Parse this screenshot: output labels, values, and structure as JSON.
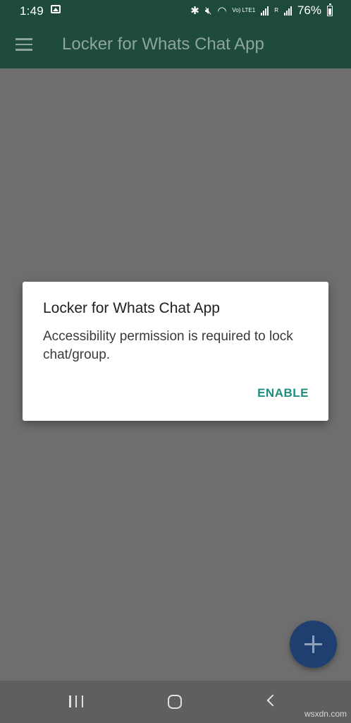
{
  "status_bar": {
    "time": "1:49",
    "network_label": "Vo) LTE1",
    "sim_label": "R",
    "battery_percent": "76%"
  },
  "app_bar": {
    "title": "Locker for Whats Chat App",
    "menu_icon": "hamburger-menu-icon"
  },
  "dialog": {
    "title": "Locker for Whats Chat App",
    "message": "Accessibility permission is required to lock chat/group.",
    "action_label": "ENABLE"
  },
  "fab": {
    "icon": "plus-icon"
  },
  "nav_bar": {
    "recents_icon": "recents-icon",
    "home_icon": "home-icon",
    "back_icon": "back-icon"
  },
  "watermark": "wsxdn.com",
  "colors": {
    "app_bar": "#1e4b3b",
    "accent": "#1c8f7f",
    "fab": "#1f3f70",
    "overlay": "#6e6e6e"
  }
}
